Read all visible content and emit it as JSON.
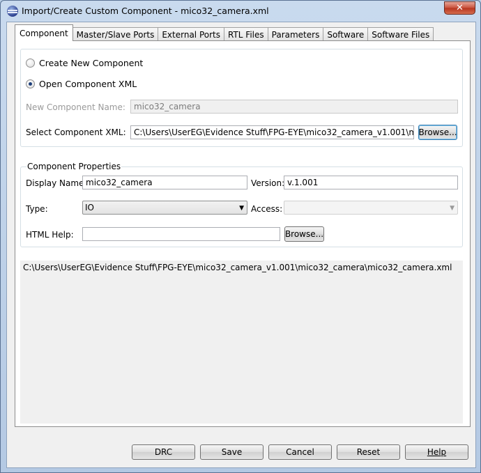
{
  "window": {
    "title": "Import/Create Custom Component - mico32_camera.xml",
    "close_label": "✕"
  },
  "tabs": [
    "Component",
    "Master/Slave Ports",
    "External Ports",
    "RTL Files",
    "Parameters",
    "Software",
    "Software Files"
  ],
  "component_source": {
    "create_new_label": "Create New Component",
    "open_xml_label": "Open Component XML",
    "new_component_name_label": "New Component Name:",
    "new_component_name_value": "mico32_camera",
    "select_xml_label": "Select Component XML:",
    "select_xml_value": "C:\\Users\\UserEG\\Evidence Stuff\\FPG-EYE\\mico32_camera_v1.001\\mico32_c",
    "browse_label": "Browse..."
  },
  "properties": {
    "group_title": "Component Properties",
    "display_name_label": "Display Name:",
    "display_name_value": "mico32_camera",
    "version_label": "Version:",
    "version_value": "v.1.001",
    "type_label": "Type:",
    "type_value": "IO",
    "access_label": "Access:",
    "access_value": "",
    "html_help_label": "HTML Help:",
    "html_help_value": "",
    "browse_label": "Browse..."
  },
  "log_text": "C:\\Users\\UserEG\\Evidence Stuff\\FPG-EYE\\mico32_camera_v1.001\\mico32_camera\\mico32_camera.xml",
  "buttons": {
    "drc": "DRC",
    "save": "Save",
    "cancel": "Cancel",
    "reset": "Reset",
    "help": "Help"
  }
}
